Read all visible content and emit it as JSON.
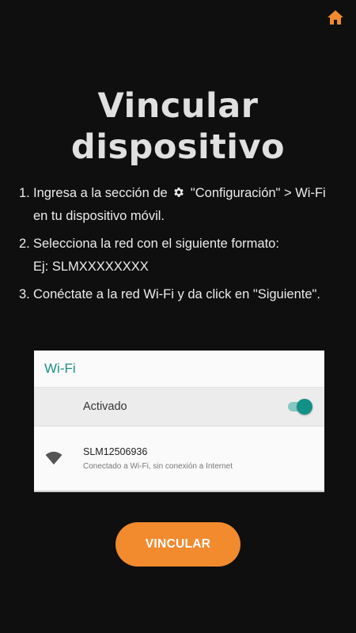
{
  "header": {
    "home_icon": "home-icon",
    "accent_color": "#f28a2e"
  },
  "title": {
    "line1": "Vincular",
    "line2": "dispositivo"
  },
  "steps": [
    {
      "num": "1.",
      "before": "Ingresa a la sección de",
      "icon": "gear-icon",
      "after": "\"Configuración\" > Wi-Fi en tu dispositivo móvil."
    },
    {
      "num": "2.",
      "line1": "Selecciona la red con el siguiente formato:",
      "line2": "Ej: SLMXXXXXXXX"
    },
    {
      "num": "3.",
      "text": "Conéctate a la red Wi-Fi y da click en \"Siguiente\"."
    }
  ],
  "wifi_screenshot": {
    "header": "Wi-Fi",
    "toggle_label": "Activado",
    "toggle_on": true,
    "network": {
      "name": "SLM12506936",
      "status": "Conectado a Wi-Fi, sin conexión a Internet",
      "icon": "wifi-signal-icon"
    }
  },
  "action": {
    "label": "VINCULAR"
  }
}
